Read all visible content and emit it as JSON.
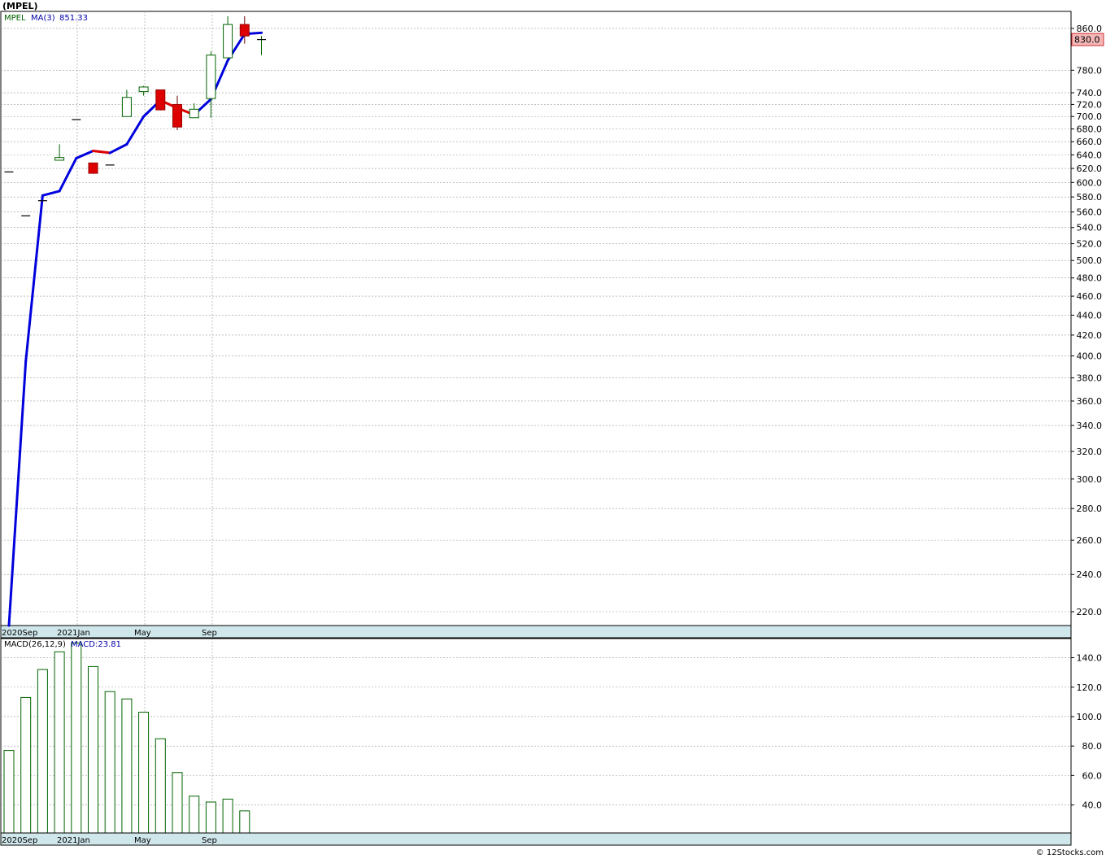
{
  "header": {
    "symbol_title": "(MPEL)",
    "price_legend_symbol": "MPEL",
    "price_legend_ma": "MA(3)",
    "price_legend_ma_value": "851.33",
    "macd_legend_name": "MACD(26,12,9)",
    "macd_legend_value": "MACD:23.81",
    "current_price_badge": "830.0",
    "copyright": "© 12Stocks.com"
  },
  "colors": {
    "up_candle": "#006400",
    "down_candle": "#dd0000",
    "ma_up": "#0000dd",
    "ma_down": "#dd0000",
    "macd_bar": "#006400",
    "time_band": "#cfe6ea",
    "badge_bg": "#f4b6b6",
    "grid": "#999999"
  },
  "chart_data": [
    {
      "type": "candlestick",
      "scale": "log",
      "ylim": [
        213,
        895
      ],
      "yticks": [
        220,
        240,
        260,
        280,
        300,
        320,
        340,
        360,
        380,
        400,
        420,
        440,
        460,
        480,
        500,
        520,
        540,
        560,
        580,
        600,
        620,
        640,
        660,
        680,
        700,
        720,
        740,
        780,
        860
      ],
      "ytick_labels": [
        "220.0",
        "240.0",
        "260.0",
        "280.0",
        "300.0",
        "320.0",
        "340.0",
        "360.0",
        "380.0",
        "400.0",
        "420.0",
        "440.0",
        "460.0",
        "480.0",
        "500.0",
        "520.0",
        "540.0",
        "560.0",
        "580.0",
        "600.0",
        "620.0",
        "640.0",
        "660.0",
        "680.0",
        "700.0",
        "720.0",
        "740.0",
        "780.0",
        "860.0"
      ],
      "xlabels": [
        "2020Sep",
        "2021Jan",
        "May",
        "Sep"
      ],
      "grid": true,
      "candles": [
        {
          "o": 615,
          "h": 615,
          "l": 615,
          "c": 615
        },
        {
          "o": 555,
          "h": 555,
          "l": 555,
          "c": 555
        },
        {
          "o": 575,
          "h": 575,
          "l": 575,
          "c": 575
        },
        {
          "o": 632,
          "h": 656,
          "l": 632,
          "c": 636
        },
        {
          "o": 695,
          "h": 695,
          "l": 695,
          "c": 695
        },
        {
          "o": 628,
          "h": 628,
          "l": 612,
          "c": 613
        },
        {
          "o": 625,
          "h": 625,
          "l": 625,
          "c": 625
        },
        {
          "o": 700,
          "h": 745,
          "l": 700,
          "c": 732
        },
        {
          "o": 742,
          "h": 752,
          "l": 735,
          "c": 750
        },
        {
          "o": 745,
          "h": 745,
          "l": 710,
          "c": 711
        },
        {
          "o": 720,
          "h": 735,
          "l": 678,
          "c": 683
        },
        {
          "o": 698,
          "h": 722,
          "l": 698,
          "c": 712
        },
        {
          "o": 730,
          "h": 815,
          "l": 698,
          "c": 808
        },
        {
          "o": 803,
          "h": 885,
          "l": 803,
          "c": 868
        },
        {
          "o": 868,
          "h": 885,
          "l": 830,
          "c": 845
        },
        {
          "o": 838,
          "h": 845,
          "l": 808,
          "c": 838
        }
      ],
      "ma_period": 3,
      "ma_values": [
        213,
        395,
        582,
        588,
        635,
        646,
        643,
        656,
        700,
        727,
        714,
        703,
        729,
        798,
        849,
        851.33
      ]
    },
    {
      "type": "bar",
      "ylim": [
        21,
        153
      ],
      "yticks": [
        40,
        60,
        80,
        100,
        120,
        140
      ],
      "ytick_labels": [
        "40.0",
        "60.0",
        "80.0",
        "100.0",
        "120.0",
        "140.0"
      ],
      "xlabels": [
        "2020Sep",
        "2021Jan",
        "May",
        "Sep"
      ],
      "grid": true,
      "values": [
        77,
        113,
        132,
        144,
        150,
        134,
        117,
        112,
        103,
        85,
        62,
        46,
        42,
        44,
        36
      ]
    }
  ]
}
